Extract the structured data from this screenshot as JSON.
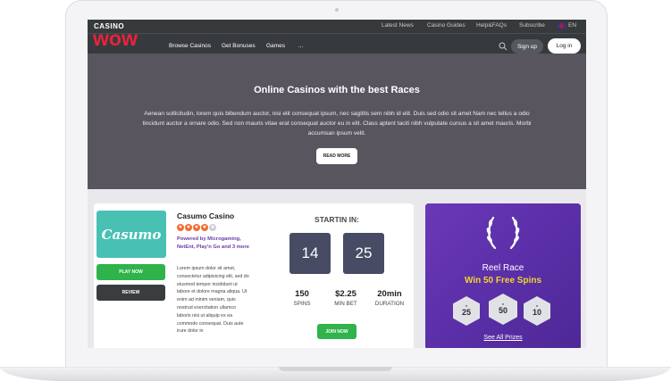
{
  "brand": {
    "logo_top": "CASINO",
    "logo_main": "wow",
    "accent": "#e8243c"
  },
  "utility_nav": [
    "Latest News",
    "Casino Guides",
    "Help&FAQs",
    "Subscribe"
  ],
  "language": {
    "label": "EN",
    "flag_icon": "uk-flag-icon"
  },
  "main_nav": [
    "Browse Casinos",
    "Get Bonuses",
    "Games",
    "..."
  ],
  "header_actions": {
    "search_icon": "search-icon",
    "signup": "Sign up",
    "login": "Log in"
  },
  "hero": {
    "title": "Online Casinos with the best Races",
    "text": "Aenean sollicitudin, lorem quis bibendum auctor, nisi elit consequat ipsum, nec sagittis sem nibh id elit. Duis sed odio sit amet Nam nec tellus a odio tincidunt auctor a ornare odio. Sed non mauris vitae erat consequat auctor eu in elit. Class aptent taciti nibh vulputate cursus a sit amet mauris. Morbi accumsan ipsum velit.",
    "button": "READ MORE"
  },
  "casino_card": {
    "logo_text": "Casumo",
    "name": "Casumo Casino",
    "rating": 4,
    "rating_max": 5,
    "powered_by": "Powered by Microgaming, NetEnt, Play'n Go and 3 more",
    "play_button": "PLAY NOW",
    "review_button": "REVIEW",
    "description": "Lorem ipsum dolor sit amet, consectetur adipisicing elit, sed do eiusmod tempor incididunt ut labore et dolore magna aliqua. Ut enim ad minim veniam, quis nostrud exercitation ullamco laboris nisi ut aliquip ex ea commodo consequat. Duis aute irure dolor in"
  },
  "countdown_card": {
    "heading": "STARTIN IN:",
    "timer": [
      "14",
      "25"
    ],
    "stats": [
      {
        "value": "150",
        "label": "SPINS"
      },
      {
        "value": "$2.25",
        "label": "MIN BET"
      },
      {
        "value": "20min",
        "label": "DURATION"
      }
    ],
    "join_button": "JOIN NOW"
  },
  "race_card": {
    "icon": "laurel-wreath-icon",
    "title": "Reel Race",
    "subtitle": "Win 50 Free Spins",
    "prizes": [
      "25",
      "50",
      "10"
    ],
    "link": "See All Prizes",
    "background": "#5b2fa8",
    "highlight": "#f2d530"
  }
}
